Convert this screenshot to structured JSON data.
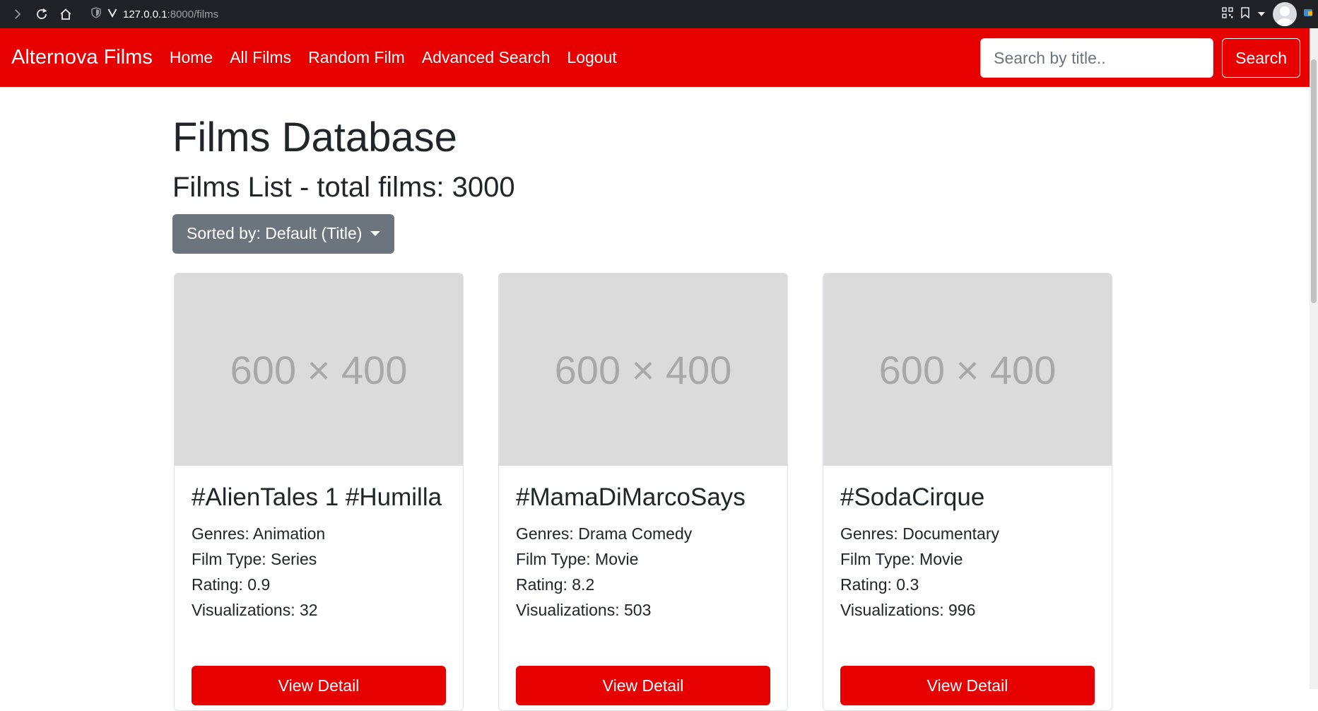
{
  "browser": {
    "url_host": "127.0.0.1",
    "url_path": ":8000/films"
  },
  "navbar": {
    "brand": "Alternova Films",
    "links": [
      "Home",
      "All Films",
      "Random Film",
      "Advanced Search",
      "Logout"
    ],
    "search_placeholder": "Search by title..",
    "search_button": "Search"
  },
  "main": {
    "title": "Films Database",
    "subtitle": "Films List - total films: 3000",
    "sort_label": "Sorted by: Default (Title)"
  },
  "cards": [
    {
      "image_label": "600 × 400",
      "title": "#AlienTales 1 #Humilla",
      "genres": "Genres: Animation",
      "film_type": "Film Type: Series",
      "rating": "Rating: 0.9",
      "visualizations": "Visualizations: 32",
      "button": "View Detail"
    },
    {
      "image_label": "600 × 400",
      "title": "#MamaDiMarcoSays",
      "genres": "Genres: Drama Comedy",
      "film_type": "Film Type: Movie",
      "rating": "Rating: 8.2",
      "visualizations": "Visualizations: 503",
      "button": "View Detail"
    },
    {
      "image_label": "600 × 400",
      "title": "#SodaCirque",
      "genres": "Genres: Documentary",
      "film_type": "Film Type: Movie",
      "rating": "Rating: 0.3",
      "visualizations": "Visualizations: 996",
      "button": "View Detail"
    }
  ],
  "colors": {
    "brand_red": "#e60000",
    "secondary_gray": "#6c757d",
    "placeholder_bg": "#dbdbdb"
  }
}
